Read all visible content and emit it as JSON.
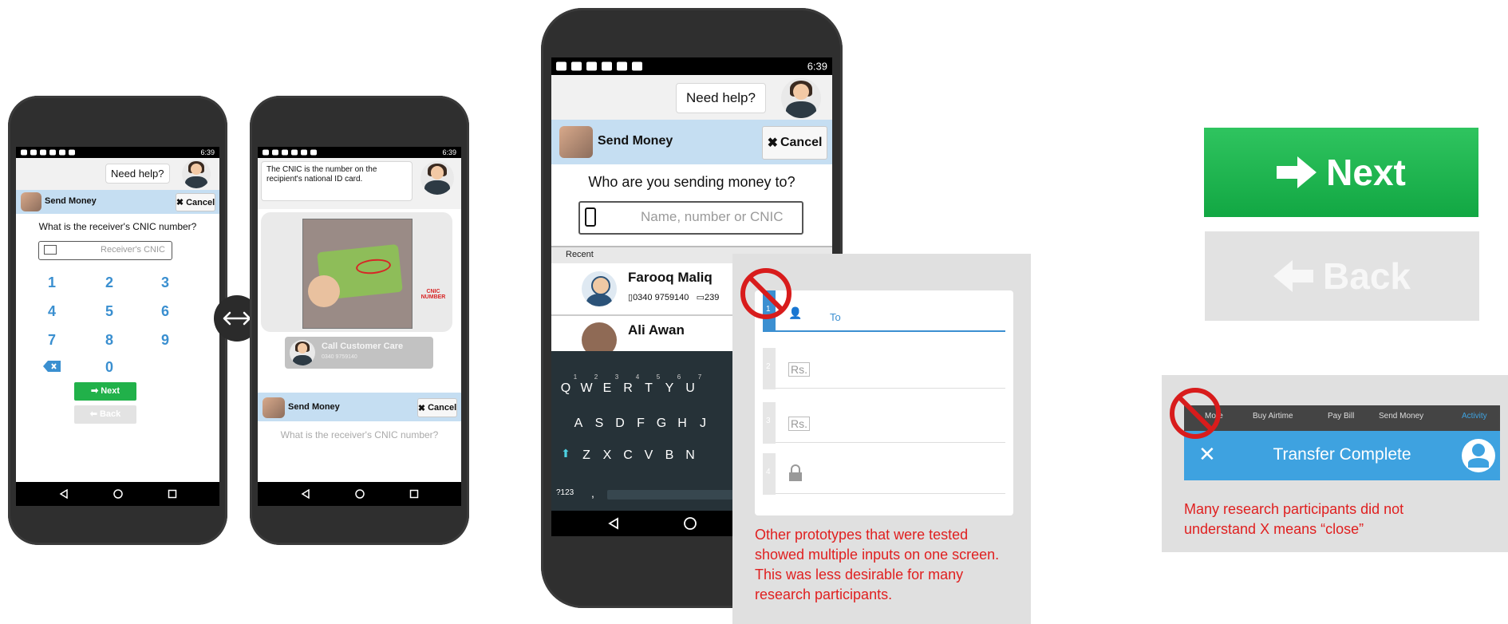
{
  "statusbar": {
    "time": "6:39"
  },
  "help": {
    "label": "Need help?"
  },
  "send_money": {
    "title": "Send Money",
    "cancel_label": "Cancel"
  },
  "phone1": {
    "question": "What is the receiver's CNIC number?",
    "input_placeholder": "Receiver's CNIC",
    "keys": [
      "1",
      "2",
      "3",
      "4",
      "5",
      "6",
      "7",
      "8",
      "9",
      "0"
    ],
    "next_label": "Next",
    "back_label": "Back"
  },
  "phone2": {
    "help_text": "The CNIC is the number on the recipient's national ID card.",
    "cnic_label": "CNIC NUMBER",
    "call_label": "Call Customer Care",
    "call_number": "0340 9759140",
    "question": "What is the receiver's CNIC number?"
  },
  "swap_icon": "left-right-arrow",
  "phone3": {
    "question": "Who are you sending money to?",
    "input_placeholder": "Name, number or CNIC",
    "recent_label": "Recent",
    "contacts": [
      {
        "name": "Farooq Maliq",
        "phone": "0340 9759140",
        "cnic": "239"
      },
      {
        "name": "Ali Awan"
      }
    ],
    "keyboard_row1": [
      "Q",
      "W",
      "E",
      "R",
      "T",
      "Y",
      "U"
    ],
    "keyboard_row1_nums": [
      "1",
      "2",
      "3",
      "4",
      "5",
      "6",
      "7"
    ],
    "keyboard_row2": [
      "A",
      "S",
      "D",
      "F",
      "G",
      "H",
      "J"
    ],
    "keyboard_row3": [
      "Z",
      "X",
      "C",
      "V",
      "B",
      "N"
    ],
    "symbols_key": "?123",
    "comma_key": ","
  },
  "multi_input": {
    "to_label": "To",
    "step_numbers": [
      "1",
      "2",
      "3",
      "4"
    ],
    "currency": "Rs.",
    "note": "Other prototypes that were tested showed multiple inputs on one screen. This was less desirable for many research participants."
  },
  "big_buttons": {
    "next_label": "Next",
    "back_label": "Back"
  },
  "transfer": {
    "tabs": [
      "More",
      "Buy Airtime",
      "Pay Bill",
      "Send Money",
      "Activity"
    ],
    "title": "Transfer Complete",
    "note": "Many research participants did not understand X means “close”"
  },
  "colors": {
    "accent_blue": "#3ea2e0",
    "green": "#21b14a",
    "red": "#e02020",
    "light_blue": "#c5def2"
  }
}
